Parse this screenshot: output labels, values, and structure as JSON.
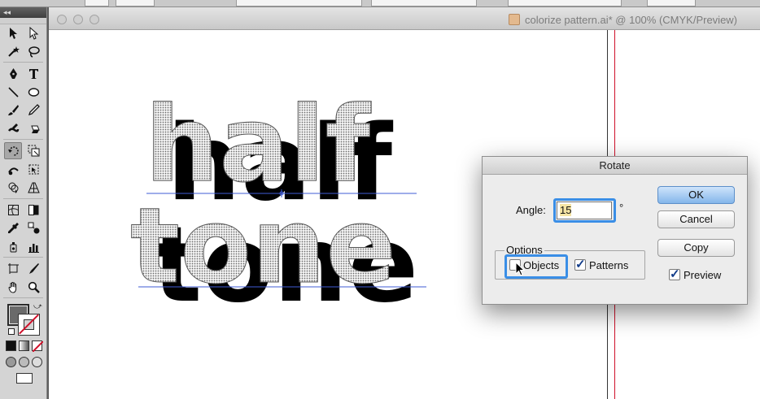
{
  "document": {
    "title": "colorize pattern.ai* @ 100% (CMYK/Preview)",
    "icon": "ai-file-icon"
  },
  "tools": {
    "rows": [
      [
        "selection-tool-icon",
        "direct-selection-tool-icon"
      ],
      [
        "magic-wand-tool-icon",
        "lasso-tool-icon"
      ],
      [
        "pen-tool-icon",
        "type-tool-icon"
      ],
      [
        "line-tool-icon",
        "ellipse-tool-icon"
      ],
      [
        "paintbrush-tool-icon",
        "pencil-tool-icon"
      ],
      [
        "blob-brush-tool-icon",
        "eraser-tool-icon"
      ],
      [
        "rotate-tool-icon",
        "scale-tool-icon"
      ],
      [
        "warp-tool-icon",
        "free-transform-tool-icon"
      ],
      [
        "shape-builder-tool-icon",
        "perspective-grid-tool-icon"
      ],
      [
        "mesh-tool-icon",
        "gradient-tool-icon"
      ],
      [
        "eyedropper-tool-icon",
        "blend-tool-icon"
      ],
      [
        "symbol-sprayer-tool-icon",
        "column-graph-tool-icon"
      ],
      [
        "artboard-tool-icon",
        "slice-tool-icon"
      ],
      [
        "hand-tool-icon",
        "zoom-tool-icon"
      ]
    ],
    "selected": "rotate-tool-icon"
  },
  "artwork": {
    "line1": "half",
    "line2": "tone"
  },
  "dialog": {
    "title": "Rotate",
    "angle_label": "Angle:",
    "angle_value": "15",
    "angle_unit": "°",
    "options_label": "Options",
    "objects_label": "Objects",
    "objects_checked": false,
    "patterns_label": "Patterns",
    "patterns_checked": true,
    "preview_label": "Preview",
    "preview_checked": true,
    "buttons": {
      "ok": "OK",
      "cancel": "Cancel",
      "copy": "Copy"
    }
  },
  "colors": {
    "focus_ring": "#3a8ee6",
    "default_button": "#84b6ea",
    "guide_line": "#3f5bd6",
    "artboard_edge": "#d0102a"
  }
}
